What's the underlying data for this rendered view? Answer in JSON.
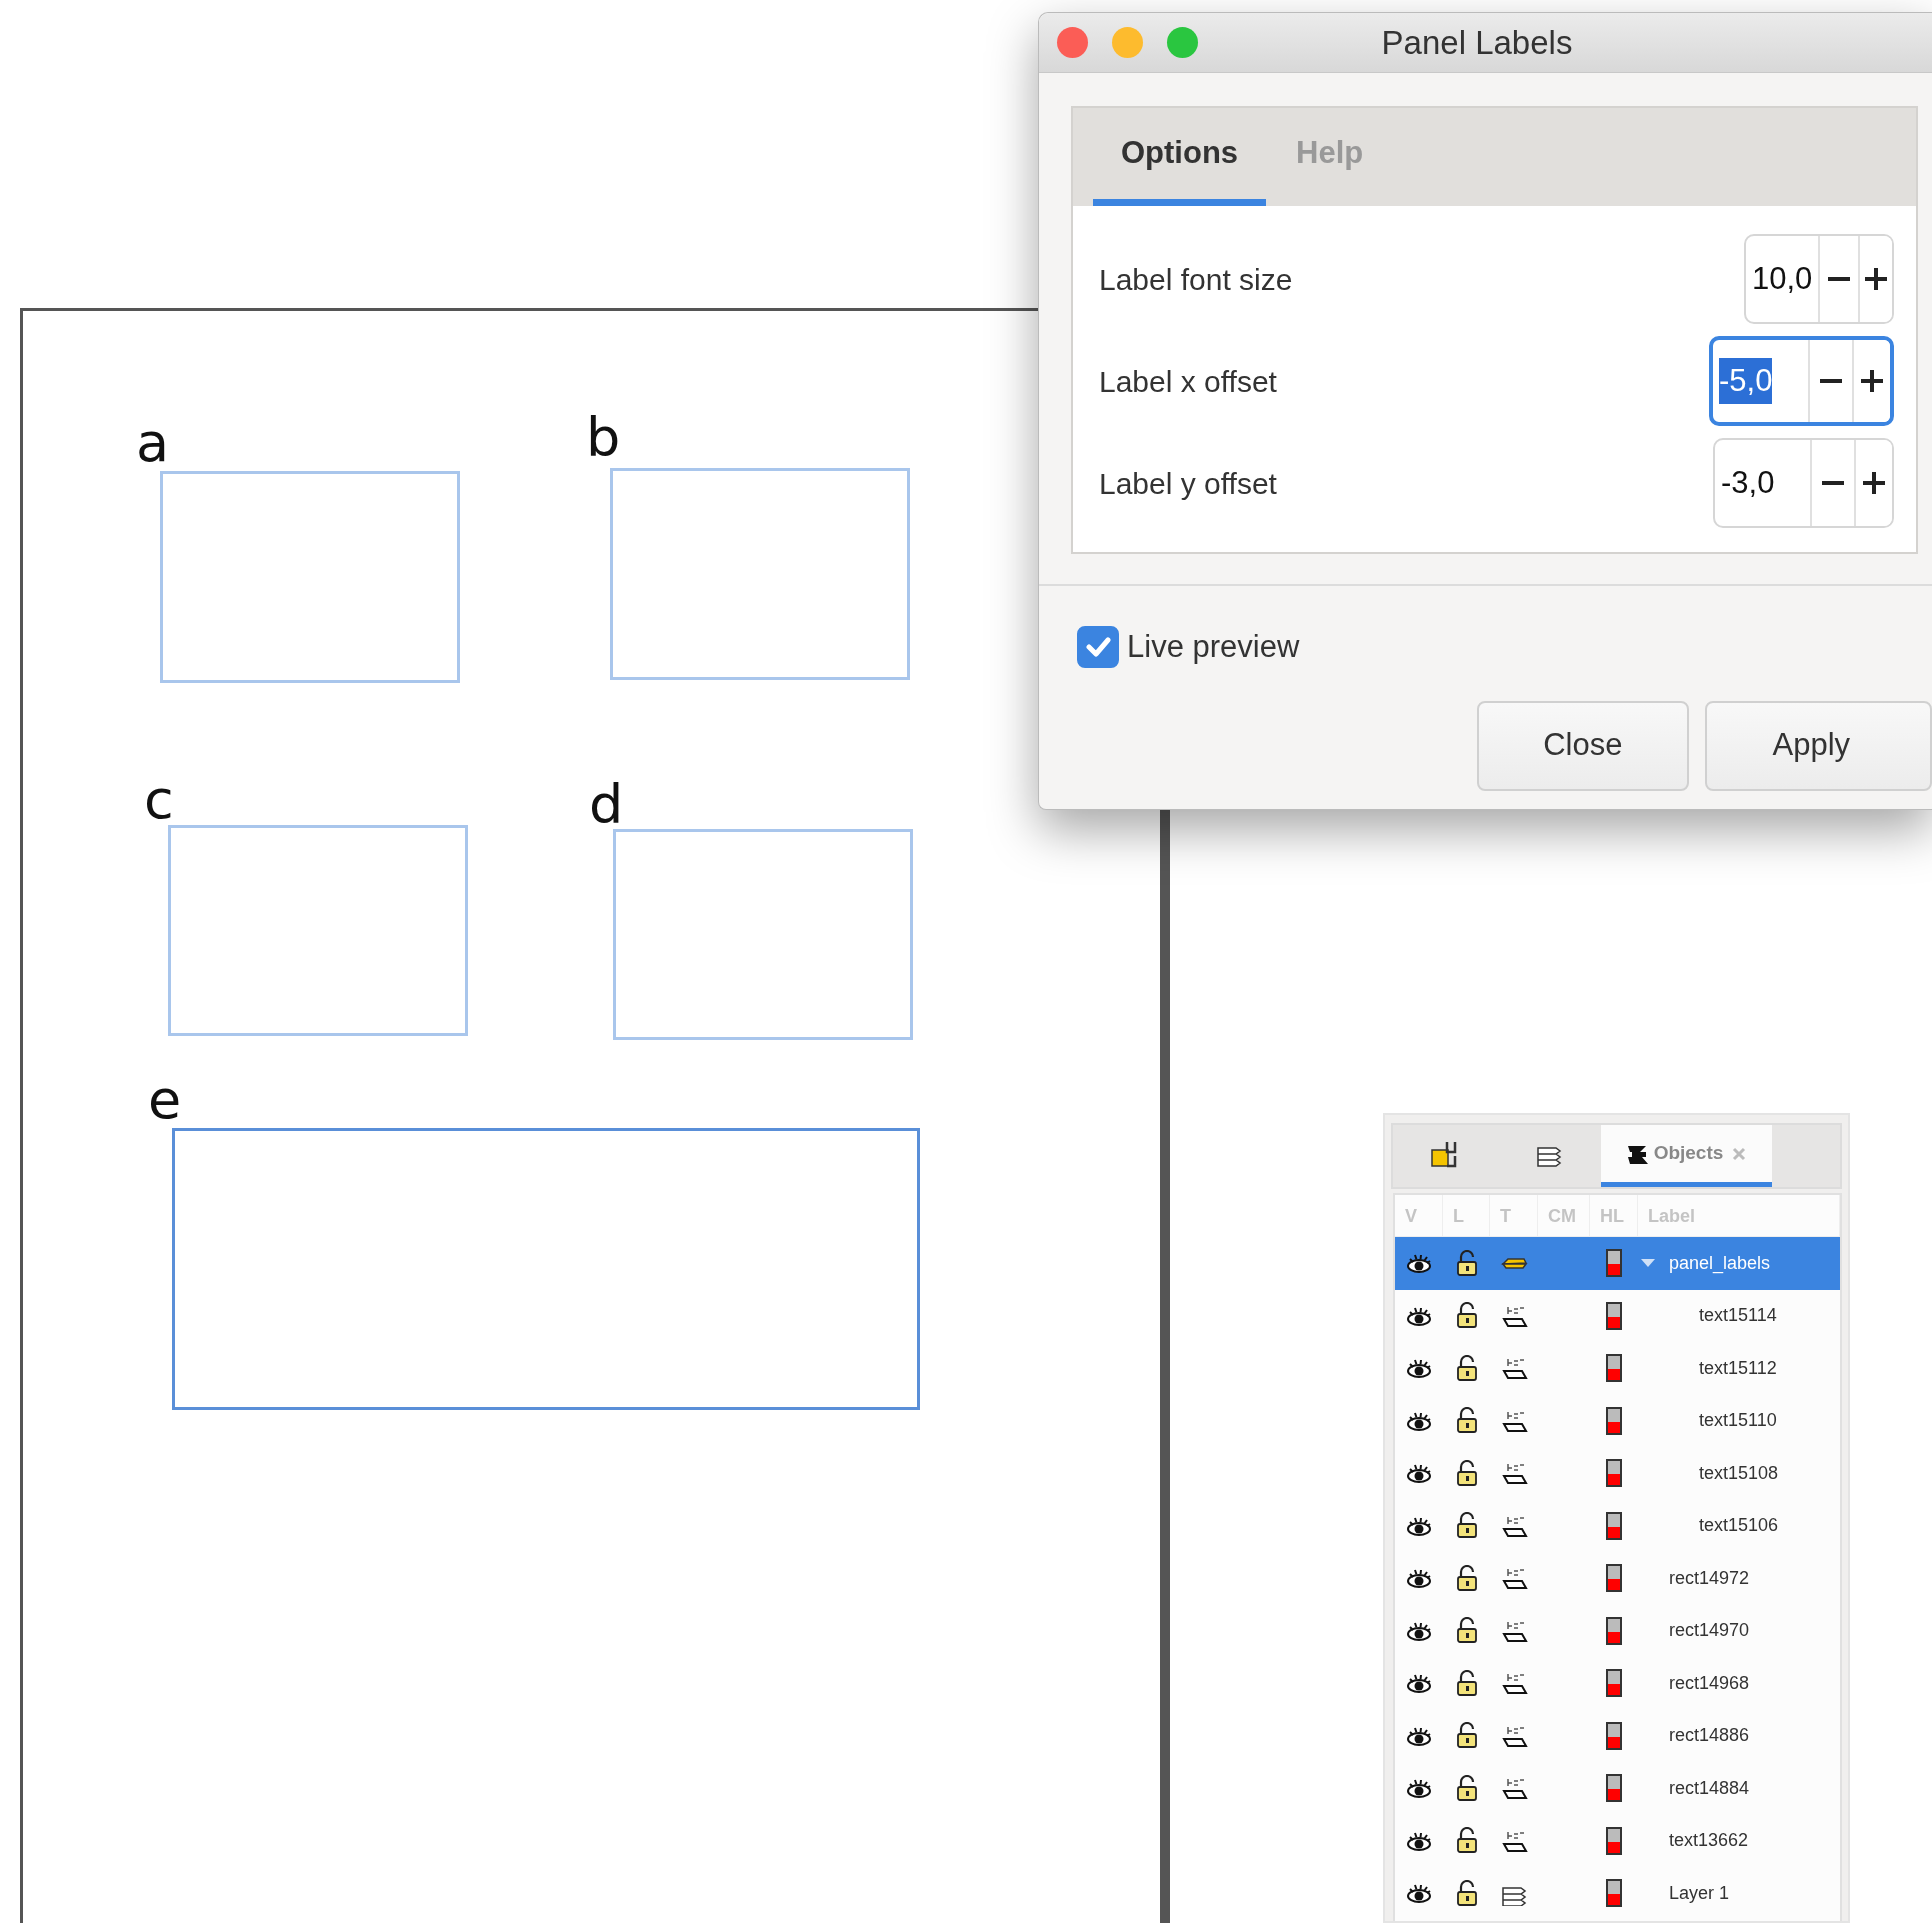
{
  "canvas": {
    "panels": [
      {
        "label": "a"
      },
      {
        "label": "b"
      },
      {
        "label": "c"
      },
      {
        "label": "d"
      },
      {
        "label": "e"
      }
    ]
  },
  "dialog": {
    "title": "Panel Labels",
    "tabs": [
      {
        "label": "Options",
        "selected": true
      },
      {
        "label": "Help",
        "selected": false
      }
    ],
    "fields": [
      {
        "label": "Label font size",
        "value": "10,0",
        "focused": false
      },
      {
        "label": "Label x offset",
        "value": "-5,0",
        "focused": true
      },
      {
        "label": "Label y offset",
        "value": "-3,0",
        "focused": false
      }
    ],
    "live_preview": {
      "label": "Live preview",
      "checked": true
    },
    "buttons": [
      "Close",
      "Apply"
    ]
  },
  "objects_panel": {
    "tabs": [
      {
        "kind": "icon",
        "selected": false
      },
      {
        "kind": "icon",
        "selected": false
      },
      {
        "kind": "labelled",
        "label": "Objects",
        "selected": true
      }
    ],
    "columns": [
      "V",
      "L",
      "T",
      "CM",
      "HL",
      "Label"
    ],
    "items": [
      {
        "label": "panel_labels",
        "kind": "group",
        "selected": true,
        "expanded": true,
        "children": [
          {
            "label": "text15114",
            "kind": "text",
            "selected": false
          },
          {
            "label": "text15112",
            "kind": "text",
            "selected": false
          },
          {
            "label": "text15110",
            "kind": "text",
            "selected": false
          },
          {
            "label": "text15108",
            "kind": "text",
            "selected": false
          },
          {
            "label": "text15106",
            "kind": "text",
            "selected": false
          }
        ]
      },
      {
        "label": "rect14972",
        "kind": "text",
        "selected": false
      },
      {
        "label": "rect14970",
        "kind": "text",
        "selected": false
      },
      {
        "label": "rect14968",
        "kind": "text",
        "selected": false
      },
      {
        "label": "rect14886",
        "kind": "text",
        "selected": false
      },
      {
        "label": "rect14884",
        "kind": "text",
        "selected": false
      },
      {
        "label": "text13662",
        "kind": "text",
        "selected": false
      },
      {
        "label": "Layer 1",
        "kind": "layer",
        "selected": false
      }
    ]
  }
}
